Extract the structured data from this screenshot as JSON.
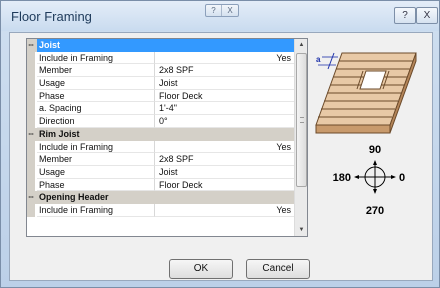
{
  "window": {
    "title": "Floor Framing",
    "mini_buttons": [
      "?",
      "X"
    ],
    "help_button": "?",
    "close_button": "X"
  },
  "grid": {
    "rows": [
      {
        "kind": "category",
        "toggle": "--",
        "label": "Joist",
        "selected": true
      },
      {
        "kind": "prop",
        "name": "Include in Framing",
        "value": "Yes",
        "align": "right"
      },
      {
        "kind": "prop",
        "name": "Member",
        "value": "2x8 SPF"
      },
      {
        "kind": "prop",
        "name": "Usage",
        "value": "Joist"
      },
      {
        "kind": "prop",
        "name": "Phase",
        "value": "Floor Deck"
      },
      {
        "kind": "prop",
        "name": "a. Spacing",
        "value": "1'-4\""
      },
      {
        "kind": "prop",
        "name": "Direction",
        "value": "0°"
      },
      {
        "kind": "category",
        "toggle": "--",
        "label": "Rim Joist",
        "selected": false
      },
      {
        "kind": "prop",
        "name": "Include in Framing",
        "value": "Yes",
        "align": "right"
      },
      {
        "kind": "prop",
        "name": "Member",
        "value": "2x8 SPF"
      },
      {
        "kind": "prop",
        "name": "Usage",
        "value": "Joist"
      },
      {
        "kind": "prop",
        "name": "Phase",
        "value": "Floor Deck"
      },
      {
        "kind": "category",
        "toggle": "--",
        "label": "Opening Header",
        "selected": false
      },
      {
        "kind": "prop",
        "name": "Include in Framing",
        "value": "Yes",
        "align": "right"
      }
    ],
    "scroll_up_arrow": "▲",
    "scroll_down_arrow": "▼"
  },
  "illustration": {
    "dimension_label": "a"
  },
  "compass": {
    "north": "90",
    "west": "180",
    "east": "0",
    "south": "270"
  },
  "buttons": {
    "ok": "OK",
    "cancel": "Cancel"
  }
}
